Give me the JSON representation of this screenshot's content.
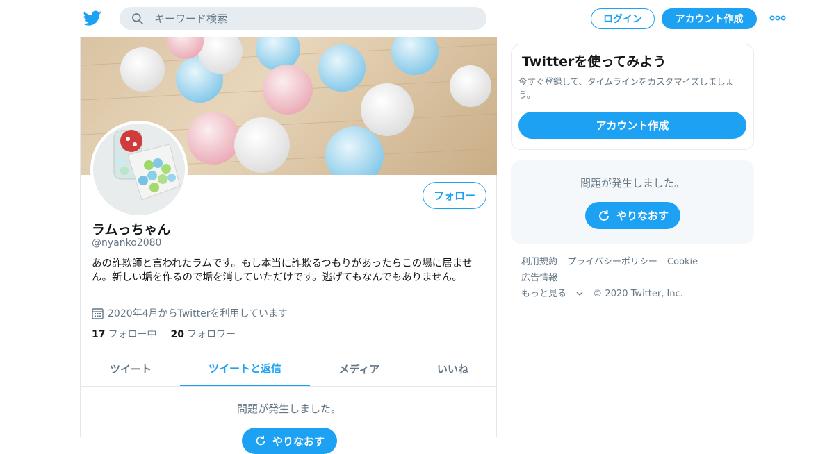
{
  "header": {
    "logo_icon": "twitter-bird-icon",
    "search_placeholder": "キーワード検索",
    "login_label": "ログイン",
    "signup_label": "アカウント作成",
    "more_icon": "more-dots-icon",
    "accent_color": "#1da1f2"
  },
  "profile": {
    "banner_image": "ramune-candy-balls-banner",
    "avatar_image": "ramune-candy-jar-avatar",
    "follow_label": "フォロー",
    "display_name": "ラムっちゃん",
    "handle": "@nyanko2080",
    "bio": "あの詐欺師と言われたラムです。もし本当に詐欺るつもりがあったらこの場に居ません。新しい垢を作るので垢を消していただけです。逃げてもなんでもありません。",
    "joined_icon": "calendar-icon",
    "joined": "2020年4月からTwitterを利用しています",
    "following_count": "17",
    "following_label": "フォロー中",
    "followers_count": "20",
    "followers_label": "フォロワー"
  },
  "tabs": [
    {
      "label": "ツイート",
      "active": false
    },
    {
      "label": "ツイートと返信",
      "active": true
    },
    {
      "label": "メディア",
      "active": false
    },
    {
      "label": "いいね",
      "active": false
    }
  ],
  "timeline": {
    "error_message": "問題が発生しました。"
  },
  "sidebar": {
    "signup_card": {
      "title": "Twitterを使ってみよう",
      "description": "今すぐ登録して、タイムラインをカスタマイズしましょう。",
      "button_label": "アカウント作成"
    },
    "error_card": {
      "message": "問題が発生しました。",
      "retry_label": "やりなおす",
      "retry_icon": "refresh-icon"
    },
    "footer": {
      "links": [
        "利用規約",
        "プライバシーポリシー",
        "Cookie",
        "広告情報",
        "もっと見る"
      ],
      "copyright": "© 2020 Twitter, Inc."
    }
  }
}
